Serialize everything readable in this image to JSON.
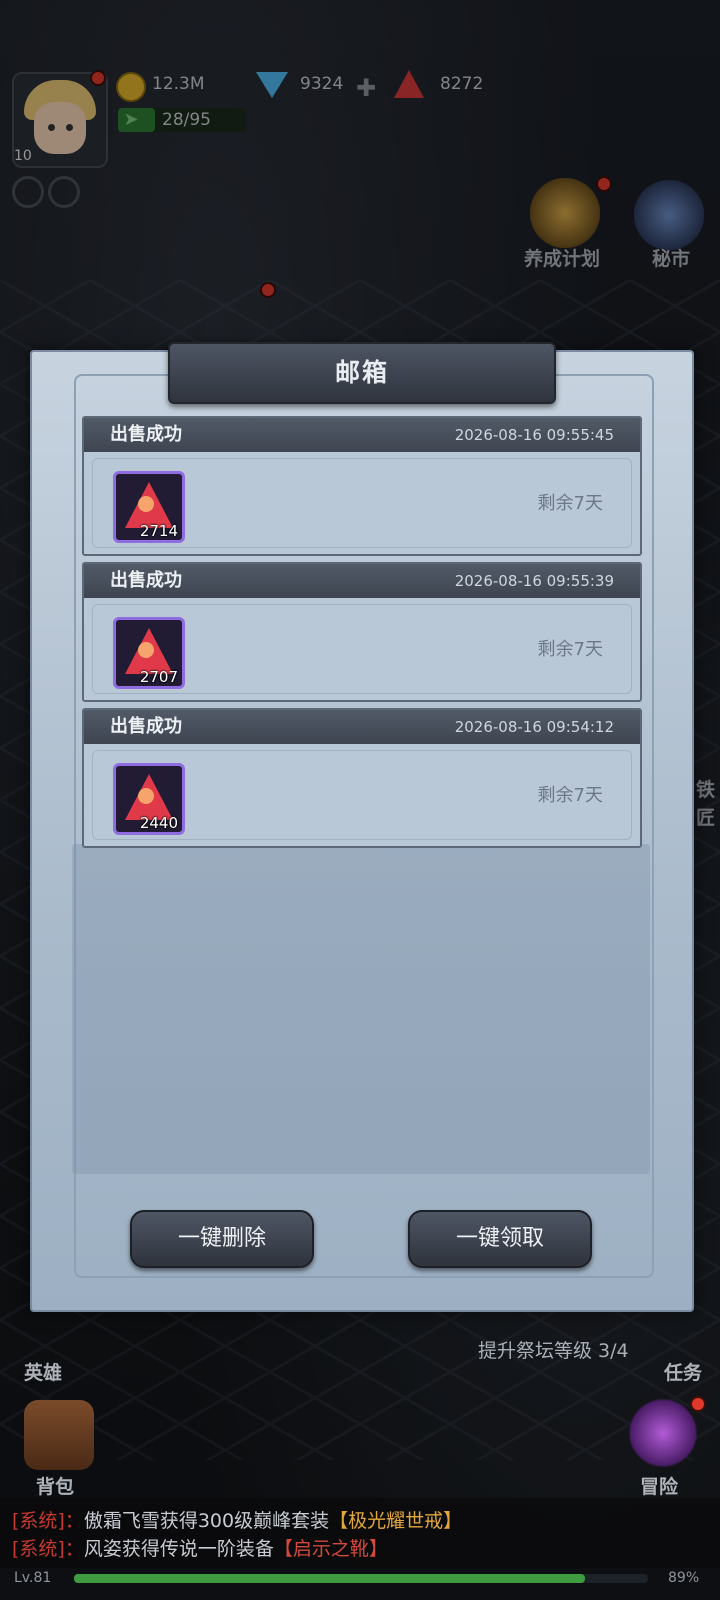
{
  "hud": {
    "player_level": "10",
    "gold": "12.3M",
    "diamonds": "9324",
    "rubies": "8272",
    "stamina": "28/95",
    "stamina_fraction": 0.29
  },
  "side_menu": {
    "growth_plan": "养成计划",
    "secret_market": "秘市",
    "blacksmith": "铁匠",
    "hero": "英雄",
    "bag": "背包",
    "quest": "任务",
    "adventure": "冒险"
  },
  "mailbox": {
    "title": "邮箱",
    "mails": [
      {
        "title": "出售成功",
        "time": "2026-08-16 09:55:45",
        "item_count": "2714",
        "remain": "剩余7天"
      },
      {
        "title": "出售成功",
        "time": "2026-08-16 09:55:39",
        "item_count": "2707",
        "remain": "剩余7天"
      },
      {
        "title": "出售成功",
        "time": "2026-08-16 09:54:12",
        "item_count": "2440",
        "remain": "剩余7天"
      }
    ],
    "delete_all": "一键删除",
    "claim_all": "一键领取"
  },
  "quest_progress": "提升祭坛等级 3/4",
  "chat": [
    {
      "tag": "[系统]",
      "sep": "：",
      "text": "傲霜飞雪获得300级巅峰套装",
      "item": "【极光耀世戒】"
    },
    {
      "tag": "[系统]",
      "sep": "：",
      "text": "风姿获得传说一阶装备",
      "item": "【启示之靴】"
    }
  ],
  "footer": {
    "level": "Lv.81",
    "exp_percent": "89%",
    "exp_fraction": 0.89
  },
  "colors": {
    "panel": "#b9c8d7",
    "header": "#3e4551",
    "item_border": "#8f6de0",
    "gem": "#e03a4a",
    "system_red": "#c63a30",
    "highlight": "#e3a83b"
  }
}
